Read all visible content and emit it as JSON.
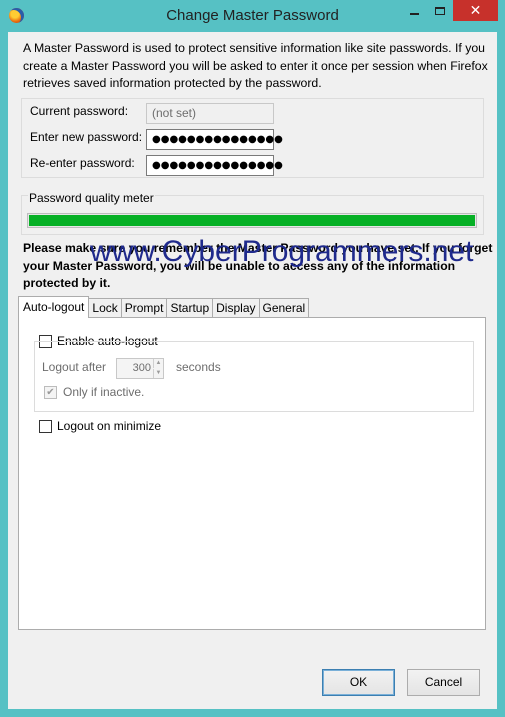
{
  "window": {
    "title": "Change Master Password",
    "close_glyph": "✕",
    "icons": {
      "app": "firefox-icon",
      "minimize": "minimize-icon",
      "maximize": "maximize-icon",
      "close": "close-icon"
    }
  },
  "intro_text": "A Master Password is used to protect sensitive information like site passwords. If you create a Master Password you will be asked to enter it once per session when Firefox retrieves saved information protected by the password.",
  "passwords": {
    "current_label": "Current password:",
    "current_value": "(not set)",
    "new_label": "Enter new password:",
    "new_value": "●●●●●●●●●●●●●●●",
    "reenter_label": "Re-enter password:",
    "reenter_value": "●●●●●●●●●●●●●●●"
  },
  "quality_meter": {
    "label": "Password quality meter",
    "fill_fraction": 1.0,
    "color": "#06b025"
  },
  "warning_text": "Please make sure you remember the Master Password you have set. If you forget your Master Password, you will be unable to access any of the information protected by it.",
  "watermark": "www.CyberProgrammers.net",
  "tabs": [
    {
      "label": "Auto-logout",
      "active": true
    },
    {
      "label": "Lock"
    },
    {
      "label": "Prompt"
    },
    {
      "label": "Startup"
    },
    {
      "label": "Display"
    },
    {
      "label": "General"
    }
  ],
  "auto_logout": {
    "enable_label": "Enable auto-logout",
    "enable_checked": false,
    "logout_after_label": "Logout after",
    "logout_after_value": "300",
    "seconds_label": "seconds",
    "only_inactive_label": "Only if inactive.",
    "only_inactive_checked": true,
    "checkmark": "✔",
    "logout_minimize_label": "Logout on minimize",
    "logout_minimize_checked": false
  },
  "buttons": {
    "ok": "OK",
    "cancel": "Cancel"
  }
}
